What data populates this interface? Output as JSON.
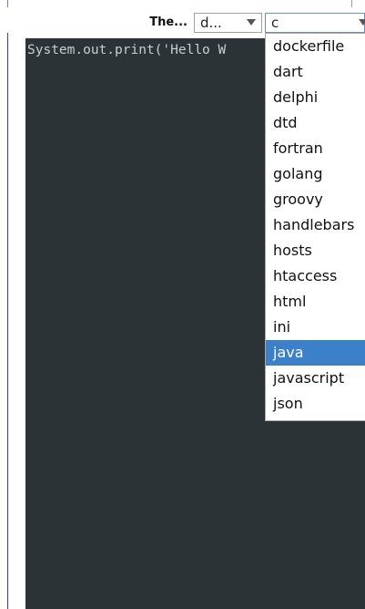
{
  "toolbar": {
    "theme_label": "The...",
    "theme_select": {
      "value": "d..."
    },
    "language_select": {
      "value": "c"
    }
  },
  "editor": {
    "code": "System.out.print('Hello W"
  },
  "language_dropdown": {
    "options": [
      "dockerfile",
      "dart",
      "delphi",
      "dtd",
      "fortran",
      "golang",
      "groovy",
      "handlebars",
      "hosts",
      "htaccess",
      "html",
      "ini",
      "java",
      "javascript",
      "json"
    ],
    "selected_index": 12
  },
  "colors": {
    "editor_background": "#2b3336",
    "selected_option": "#3b80c9"
  }
}
